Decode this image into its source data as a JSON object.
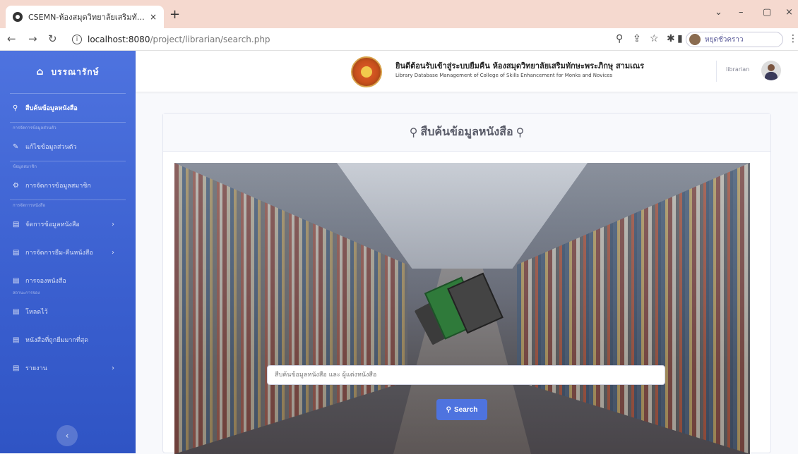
{
  "browser": {
    "tab_title": "CSEMN-ห้องสมุดวิทยาลัยเสริมทักษะ",
    "tab_close": "×",
    "new_tab": "+",
    "url_host": "localhost:8080",
    "url_path": "/project/librarian/search.php",
    "profile_label": "หยุดชั่วคราว",
    "window_controls": [
      "⌄",
      "–",
      "▢",
      "×"
    ]
  },
  "sidebar": {
    "brand": "บรรณารักษ์",
    "items": [
      {
        "label": "สืบค้นข้อมูลหนังสือ",
        "icon": "search-icon",
        "active": true
      },
      {
        "heading": "การจัดการข้อมูลส่วนตัว"
      },
      {
        "label": "แก้ไขข้อมูลส่วนตัว",
        "icon": "edit-icon"
      },
      {
        "heading": "ข้อมูลสมาชิก"
      },
      {
        "label": "การจัดการข้อมูลสมาชิก",
        "icon": "gear-icon"
      },
      {
        "heading": "การจัดการหนังสือ"
      },
      {
        "label": "จัดการข้อมูลหนังสือ",
        "icon": "book-icon",
        "chevron": true
      },
      {
        "label": "การจัดการยืม-คืนหนังสือ",
        "icon": "exchange-icon",
        "chevron": true
      },
      {
        "label": "การจองหนังสือ",
        "icon": "bookmark-icon"
      },
      {
        "heading": "สถานะการจอง"
      },
      {
        "label": "โหลดไว้",
        "icon": "list-icon"
      },
      {
        "label": "หนังสือที่ถูกยืมมากที่สุด",
        "icon": "chart-icon"
      },
      {
        "label": "รายงาน",
        "icon": "report-icon",
        "chevron": true
      }
    ],
    "toggle": "‹"
  },
  "header": {
    "title": "ยินดีต้อนรับเข้าสู่ระบบยืมคืน ห้องสมุดวิทยาลัยเสริมทักษะพระภิกษุ สามเณร",
    "subtitle": "Library Database Management of College of Skills Enhancement for Monks and Novices",
    "user_name": "librarian"
  },
  "card": {
    "title": "สืบค้นข้อมูลหนังสือ"
  },
  "search": {
    "placeholder": "สืบค้นข้อมูลหนังสือ และ ผู้แต่งหนังสือ",
    "button_label": "Search"
  },
  "colors": {
    "primary": "#4e73df",
    "tab_bar": "#f5d9cf"
  }
}
